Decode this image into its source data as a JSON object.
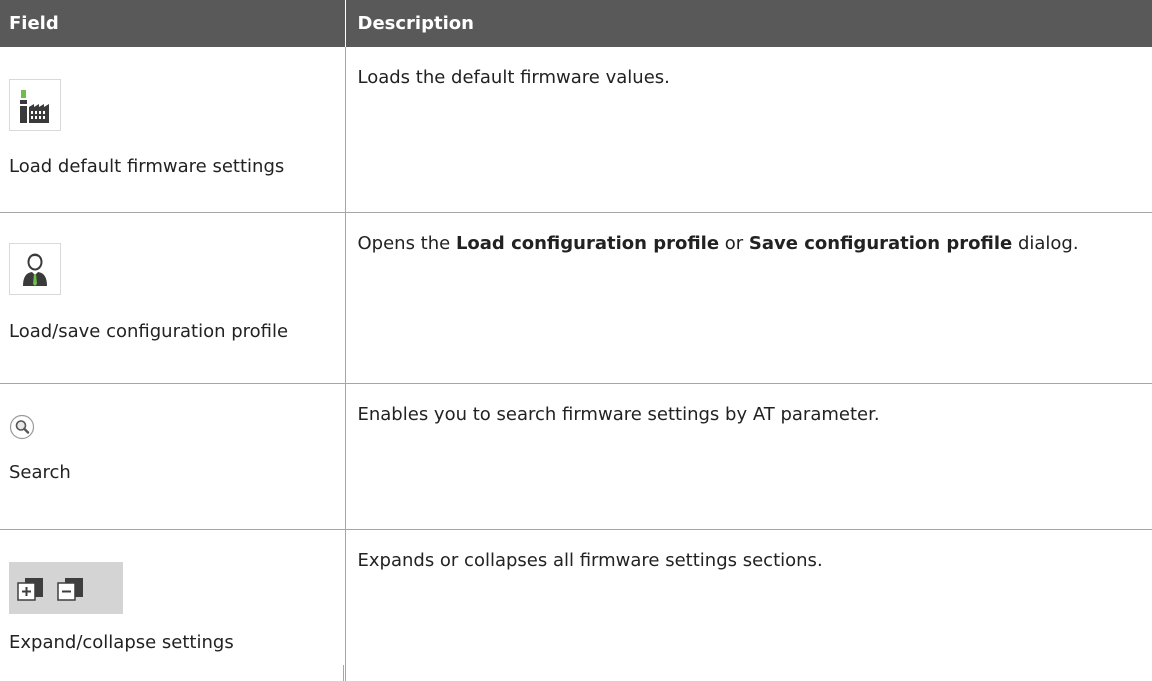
{
  "header": {
    "field": "Field",
    "description": "Description"
  },
  "rows": [
    {
      "field_label": "Load default firmware settings",
      "icon": "factory-icon",
      "description": "Loads the default firmware values."
    },
    {
      "field_label": "Load/save configuration profile",
      "icon": "user-profile-icon",
      "description_parts": {
        "prefix": "Opens the ",
        "bold1": "Load configuration profile",
        "middle": " or ",
        "bold2": "Save configuration profile",
        "suffix": " dialog."
      }
    },
    {
      "field_label": "Search",
      "icon": "search-icon",
      "description": "Enables you to search firmware settings by AT parameter."
    },
    {
      "field_label": "Expand/collapse settings",
      "icon": "expand-collapse-icon",
      "description": "Expands or collapses all firmware settings sections."
    }
  ],
  "colors": {
    "header_bg": "#595959",
    "green_accent": "#5cb85c",
    "icon_dark": "#3a3a3a"
  }
}
